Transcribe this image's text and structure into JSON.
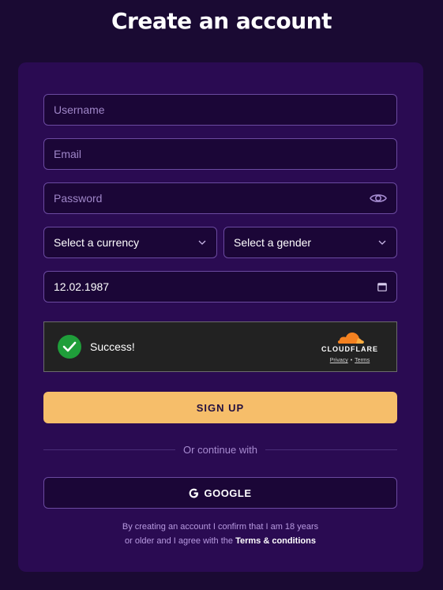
{
  "page": {
    "title": "Create an account"
  },
  "form": {
    "username_placeholder": "Username",
    "email_placeholder": "Email",
    "password_placeholder": "Password",
    "currency_select": "Select a currency",
    "gender_select": "Select a gender",
    "date_value": "12.02.1987"
  },
  "captcha": {
    "status": "Success!",
    "brand": "CLOUDFLARE",
    "privacy": "Privacy",
    "separator": "•",
    "terms": "Terms"
  },
  "actions": {
    "signup_label": "SIGN UP",
    "divider_text": "Or continue with",
    "google_label": "GOOGLE"
  },
  "legal": {
    "line1": "By creating an account I confirm that I am 18 years",
    "line2_prefix": "or older and I agree with the",
    "terms_link": "Terms & conditions"
  },
  "colors": {
    "background": "#1a0a33",
    "card": "#2a0b52",
    "accent": "#f6be6a",
    "success": "#1f9e3a",
    "cloudflare": "#f48120"
  },
  "icons": {
    "password_toggle": "eye-icon",
    "select_arrow": "chevron-down-icon",
    "date_picker": "calendar-icon",
    "captcha_status": "check-icon",
    "captcha_brand": "cloudflare-logo",
    "google": "google-g-icon"
  }
}
